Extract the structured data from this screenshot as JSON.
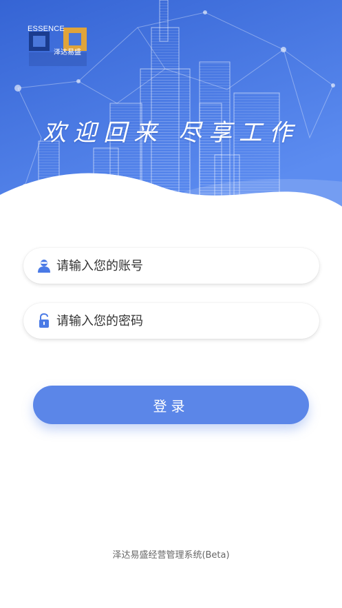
{
  "logo": {
    "text_en": "ESSENCE",
    "text_cn": "泽达易盛"
  },
  "hero": {
    "slogan": "欢迎回来 尽享工作",
    "colors": {
      "gradient_top": "#3a68d8",
      "gradient_bottom": "#5f8ef0"
    }
  },
  "form": {
    "username": {
      "value": "",
      "placeholder": "请输入您的账号",
      "icon": "user-icon"
    },
    "password": {
      "value": "",
      "placeholder": "请输入您的密码",
      "icon": "lock-icon"
    },
    "login_label": "登录"
  },
  "footer": {
    "text": "泽达易盛经营管理系统(Beta)"
  },
  "colors": {
    "accent": "#5b86e8",
    "icon": "#4a7ae6"
  }
}
